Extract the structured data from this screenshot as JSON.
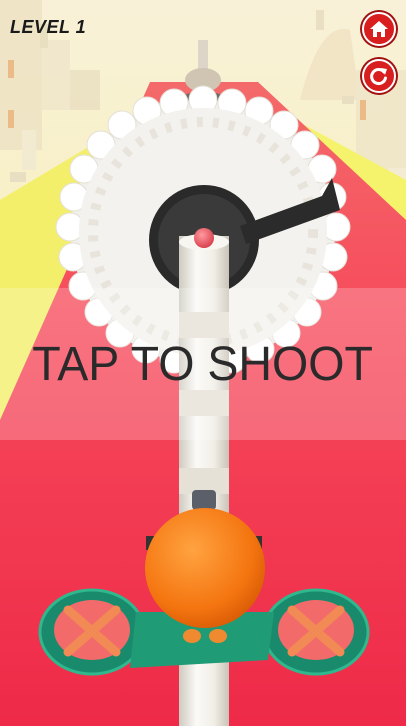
{
  "hud": {
    "level_label": "LEVEL 1"
  },
  "buttons": {
    "home": {
      "icon": "home-icon"
    },
    "restart": {
      "icon": "restart-icon"
    }
  },
  "overlay": {
    "instruction": "TAP TO SHOOT"
  },
  "colors": {
    "track": "#f5384f",
    "side_yellow": "#f4f168",
    "sky": "#f7f0c8",
    "pole": "#f2f0ea",
    "ball_target": "#e24a55",
    "player": "#f57a10",
    "spinner_ring": "#1ea07a",
    "spinner_x": "#f28a55",
    "hud_button": "#d81e1e"
  }
}
